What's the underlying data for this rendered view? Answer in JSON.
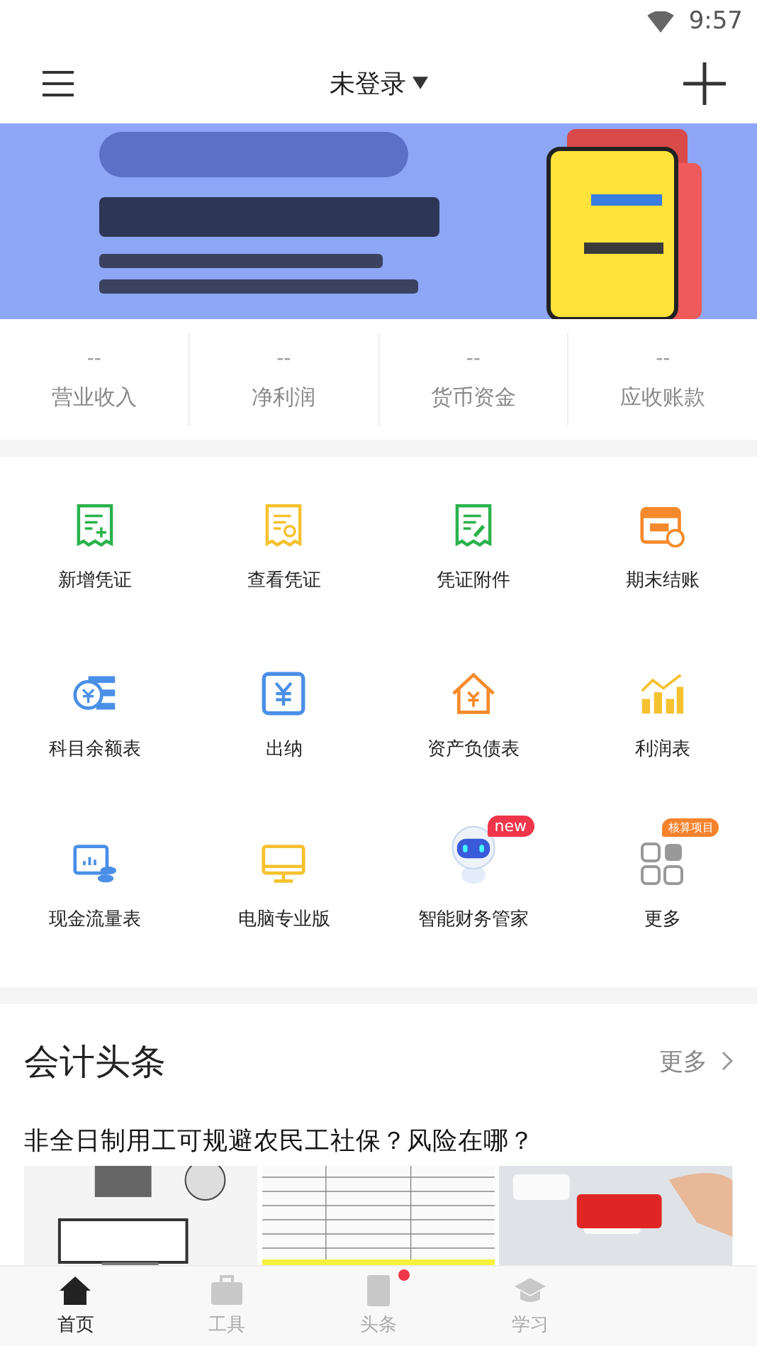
{
  "status_bar": {
    "time": "9:57"
  },
  "header": {
    "title": "未登录"
  },
  "stats": [
    {
      "value": "--",
      "label": "营业收入"
    },
    {
      "value": "--",
      "label": "净利润"
    },
    {
      "value": "--",
      "label": "货币资金"
    },
    {
      "value": "--",
      "label": "应收账款"
    }
  ],
  "shortcuts": [
    {
      "kind": "voucher-add",
      "label": "新增凭证"
    },
    {
      "kind": "voucher-view",
      "label": "查看凭证"
    },
    {
      "kind": "voucher-attach",
      "label": "凭证附件"
    },
    {
      "kind": "calendar",
      "label": "期末结账"
    },
    {
      "kind": "coins",
      "label": "科目余额表"
    },
    {
      "kind": "cashier",
      "label": "出纳"
    },
    {
      "kind": "house",
      "label": "资产负债表"
    },
    {
      "kind": "chart",
      "label": "利润表"
    },
    {
      "kind": "cashflow",
      "label": "现金流量表"
    },
    {
      "kind": "monitor",
      "label": "电脑专业版"
    },
    {
      "kind": "robot",
      "label": "智能财务管家",
      "badge": "new"
    },
    {
      "kind": "grid",
      "label": "更多",
      "badge": "核算项目"
    }
  ],
  "news": {
    "title": "会计头条",
    "more": "更多",
    "headline": "非全日制用工可规避农民工社保？风险在哪？"
  },
  "tab_bar": [
    {
      "kind": "home",
      "label": "首页",
      "selected": true,
      "dot": false
    },
    {
      "kind": "briefcase",
      "label": "工具",
      "selected": false,
      "dot": false
    },
    {
      "kind": "book",
      "label": "头条",
      "selected": false,
      "dot": true
    },
    {
      "kind": "cap",
      "label": "学习",
      "selected": false,
      "dot": false
    }
  ]
}
